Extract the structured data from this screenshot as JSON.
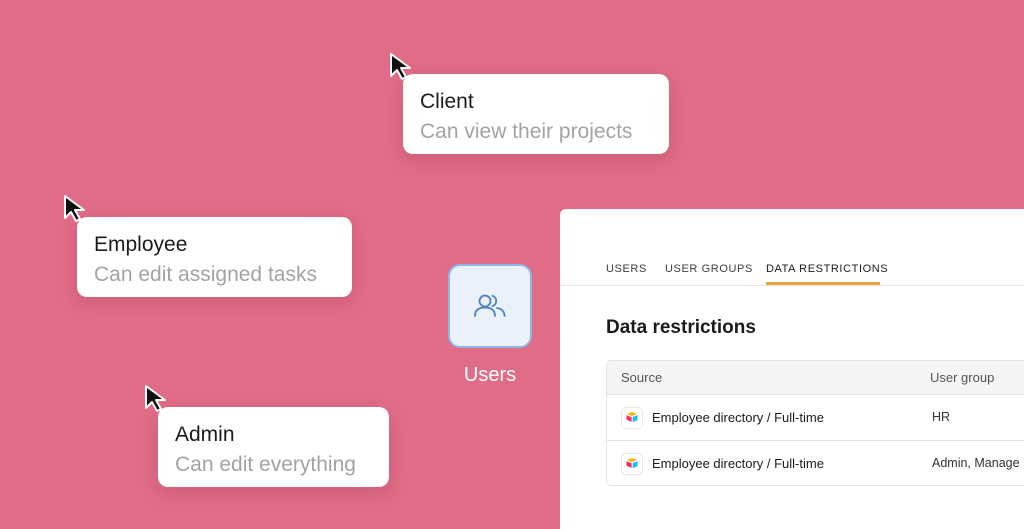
{
  "roles": [
    {
      "title": "Client",
      "description": "Can view their projects"
    },
    {
      "title": "Employee",
      "description": "Can edit assigned tasks"
    },
    {
      "title": "Admin",
      "description": "Can edit everything"
    }
  ],
  "users_tile": {
    "label": "Users",
    "icon": "users-icon"
  },
  "panel": {
    "tabs": [
      "USERS",
      "USER GROUPS",
      "DATA RESTRICTIONS"
    ],
    "active_tab": "DATA RESTRICTIONS",
    "heading": "Data restrictions",
    "table": {
      "columns": [
        "Source",
        "User group"
      ],
      "rows": [
        {
          "source": "Employee directory / Full-time",
          "user_group": "HR"
        },
        {
          "source": "Employee directory / Full-time",
          "user_group": "Admin, Manage"
        }
      ]
    }
  },
  "colors": {
    "background": "#e06c87",
    "accent": "#f0a33c",
    "tile_border": "#8db4e6"
  }
}
